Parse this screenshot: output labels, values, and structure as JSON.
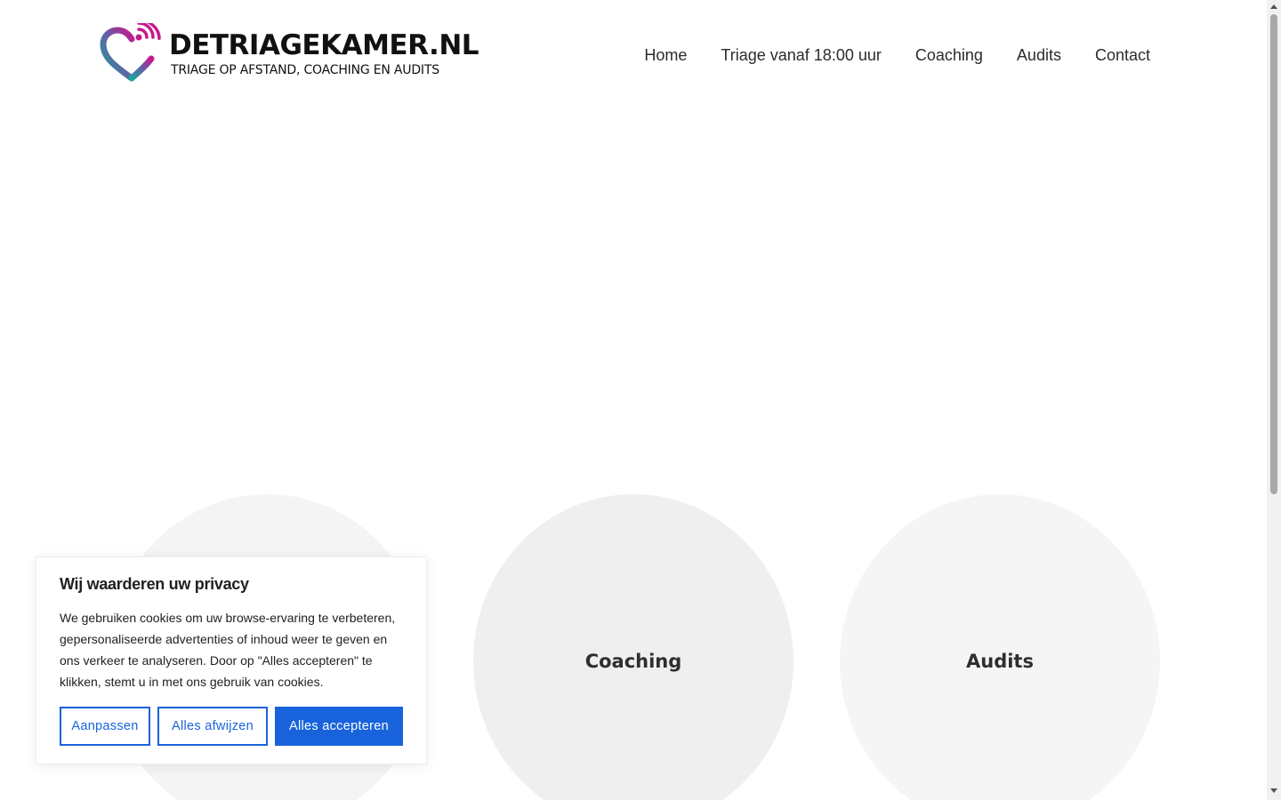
{
  "header": {
    "logo_title": "DETRIAGEKAMER.NL",
    "logo_tagline": "TRIAGE OP AFSTAND, COACHING EN AUDITS",
    "nav": [
      {
        "label": "Home"
      },
      {
        "label": "Triage vanaf 18:00 uur"
      },
      {
        "label": "Coaching"
      },
      {
        "label": "Audits"
      },
      {
        "label": "Contact"
      }
    ]
  },
  "services": [
    {
      "label": ""
    },
    {
      "label": "Coaching"
    },
    {
      "label": "Audits"
    }
  ],
  "cookie_banner": {
    "title": "Wij waarderen uw privacy",
    "text": "We gebruiken cookies om uw browse-ervaring te verbeteren, gepersonaliseerde advertenties of inhoud weer te geven en ons verkeer te analyseren. Door op \"Alles accepteren\" te klikken, stemt u in met ons gebruik van cookies.",
    "customize_label": "Aanpassen",
    "reject_label": "Alles afwijzen",
    "accept_label": "Alles accepteren"
  },
  "colors": {
    "accent": "#1863dc",
    "logo_gradient_start": "#1aa39a",
    "logo_gradient_end": "#c2198f"
  }
}
